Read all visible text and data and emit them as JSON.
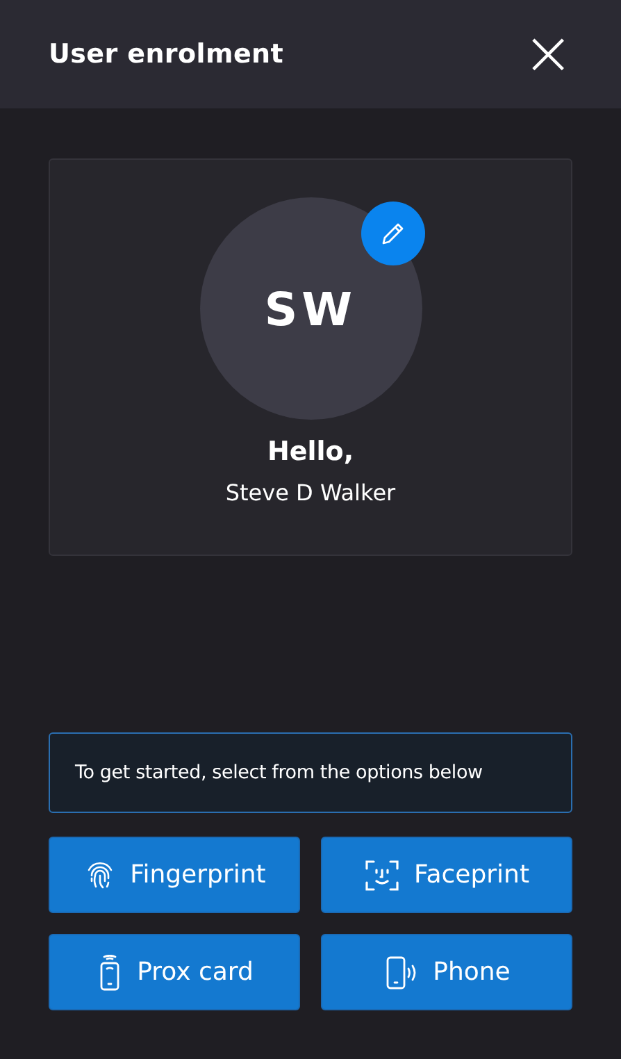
{
  "window": {
    "title": "User enrolment",
    "close": "×"
  },
  "profile": {
    "initials": "SW",
    "greeting": "Hello,",
    "name": "Steve D Walker"
  },
  "info": "To get started, select from the options below",
  "options": [
    {
      "kind": "fingerprint",
      "label": "Fingerprint"
    },
    {
      "kind": "face",
      "label": "Faceprint"
    },
    {
      "kind": "card",
      "label": "Prox card"
    },
    {
      "kind": "phone",
      "label": "Phone"
    }
  ]
}
